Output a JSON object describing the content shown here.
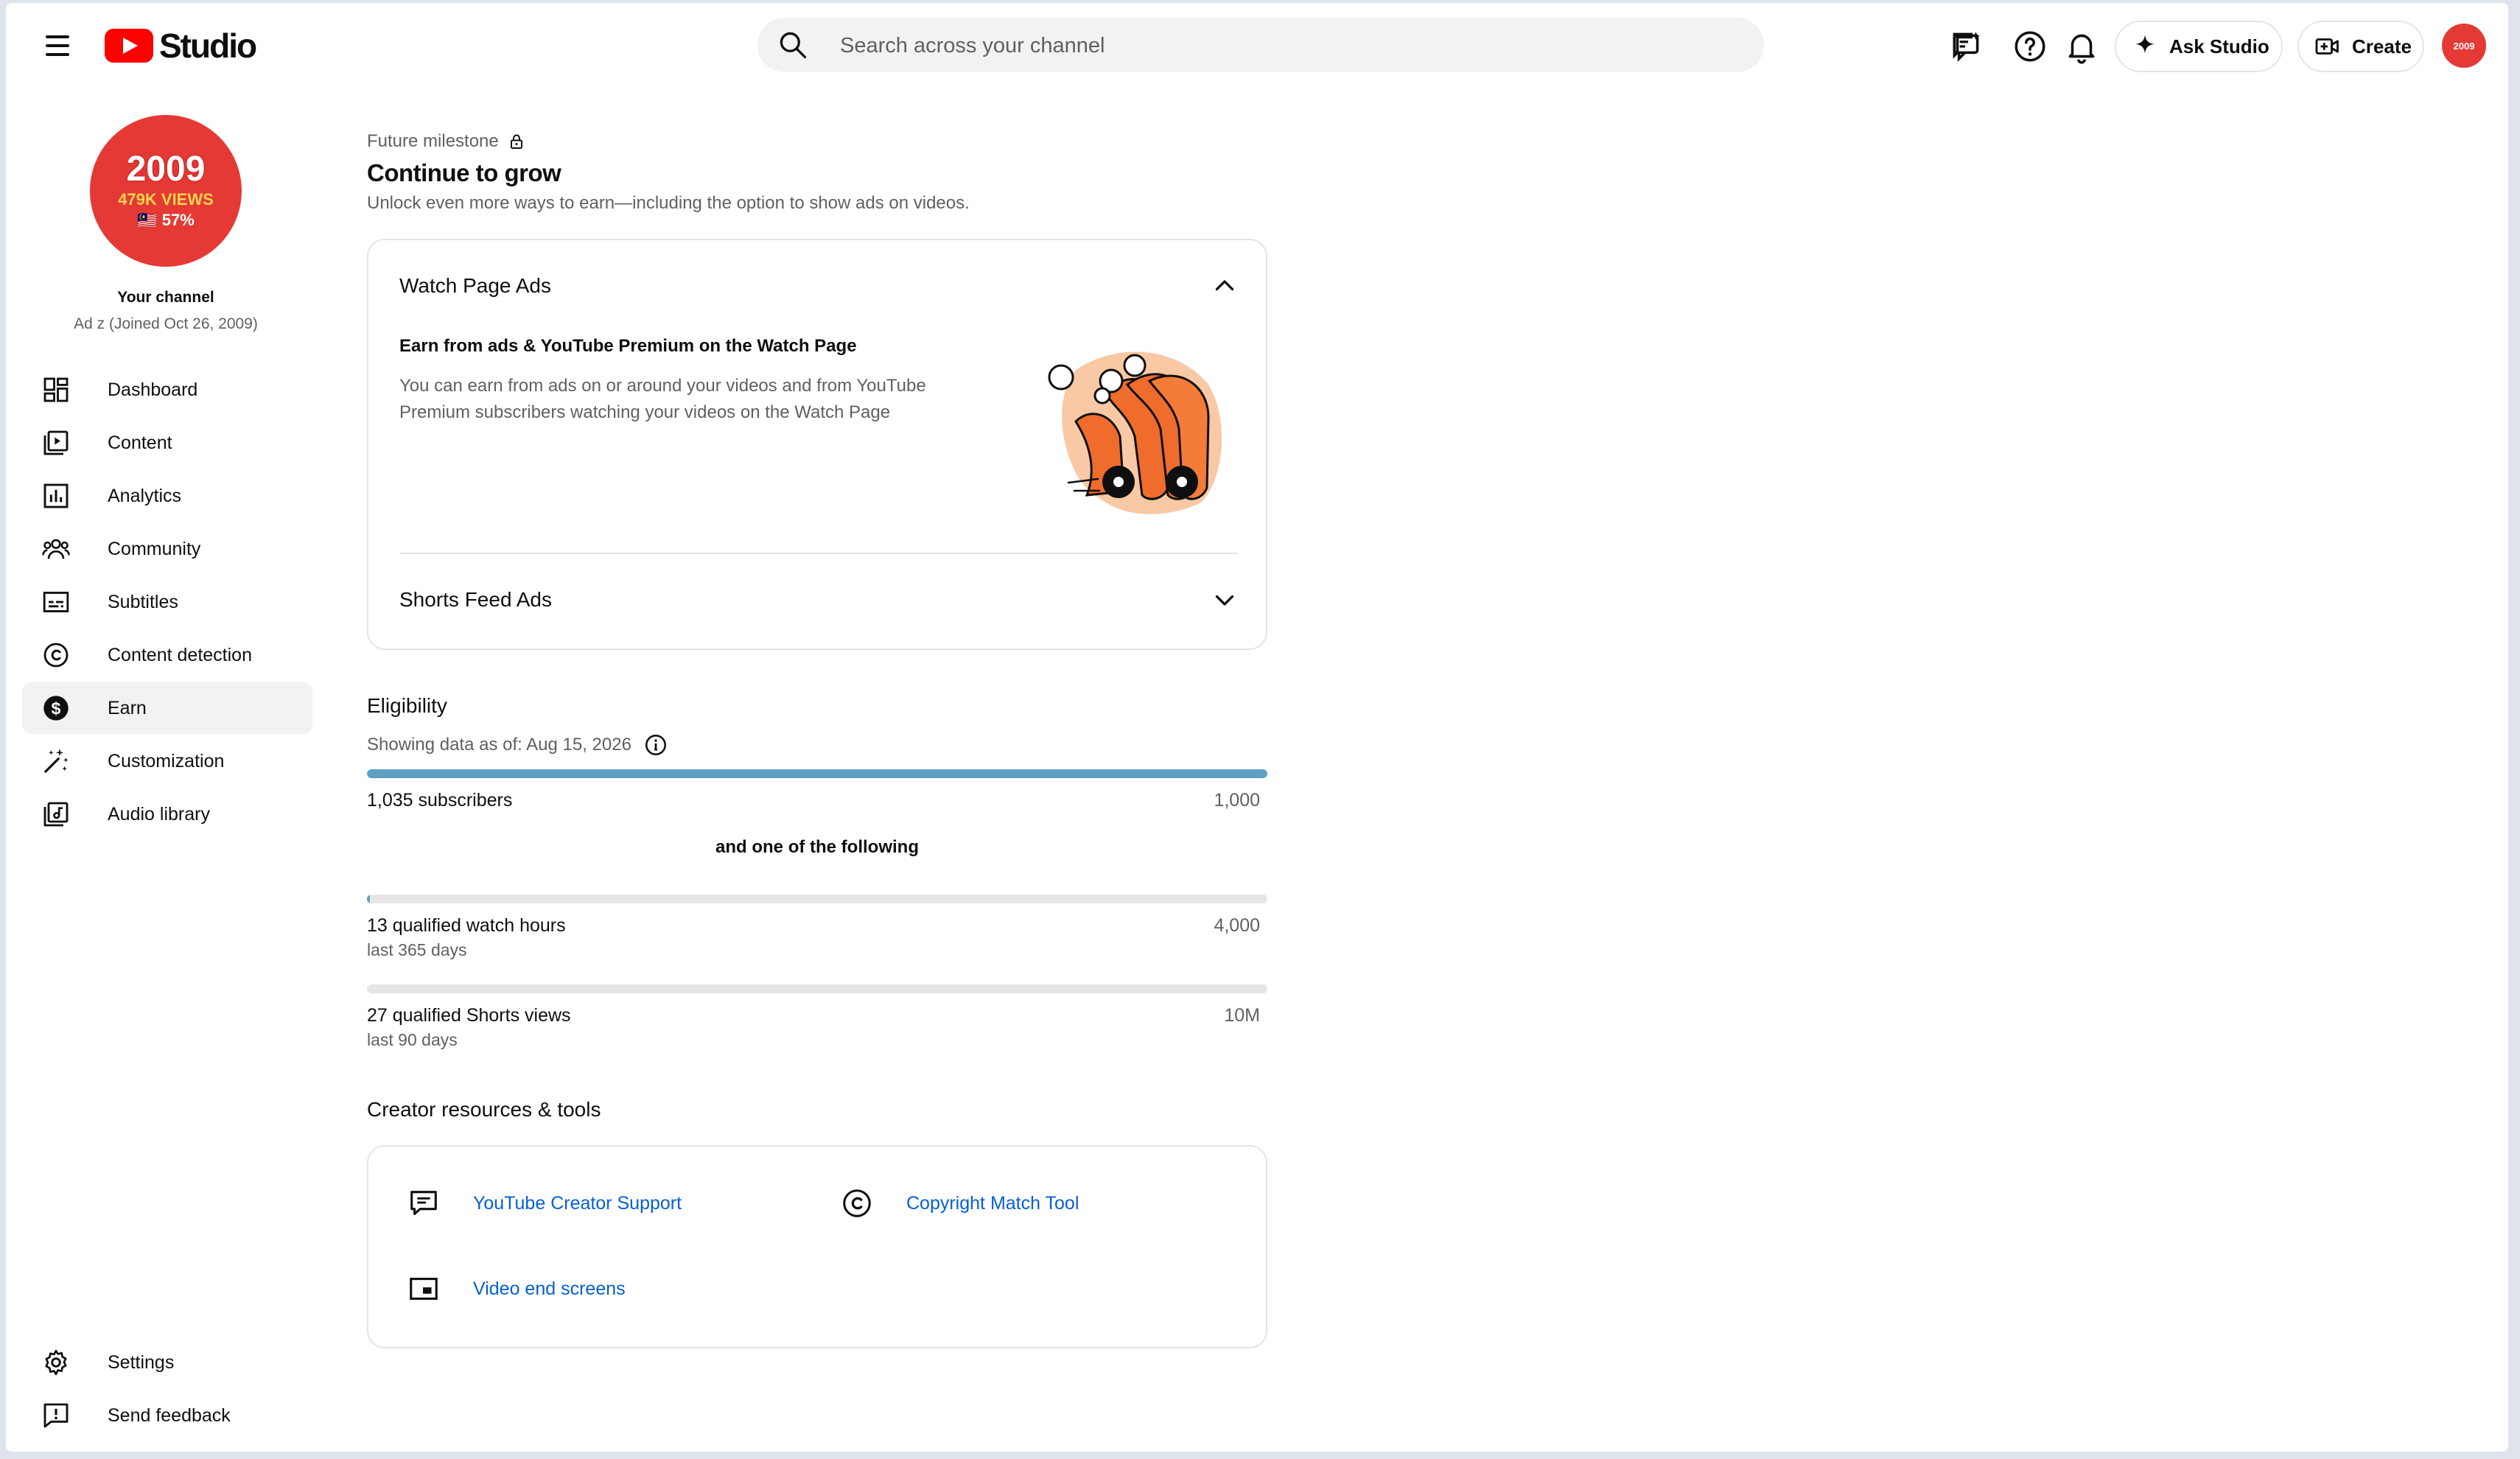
{
  "header": {
    "logo_text": "Studio",
    "search_placeholder": "Search across your channel",
    "ask_studio_label": "Ask Studio",
    "create_label": "Create",
    "avatar_small_text": "2009"
  },
  "channel": {
    "avatar_line1": "2009",
    "avatar_line2": "479K VIEWS",
    "avatar_line3": "🇲🇾 57%",
    "title": "Your channel",
    "subtitle": "Ad z (Joined Oct 26, 2009)"
  },
  "sidebar": {
    "items": [
      {
        "label": "Dashboard",
        "icon": "dashboard-icon"
      },
      {
        "label": "Content",
        "icon": "content-icon"
      },
      {
        "label": "Analytics",
        "icon": "analytics-icon"
      },
      {
        "label": "Community",
        "icon": "community-icon"
      },
      {
        "label": "Subtitles",
        "icon": "subtitles-icon"
      },
      {
        "label": "Content detection",
        "icon": "copyright-icon"
      },
      {
        "label": "Earn",
        "icon": "dollar-icon",
        "active": true
      },
      {
        "label": "Customization",
        "icon": "magic-wand-icon"
      },
      {
        "label": "Audio library",
        "icon": "audio-library-icon"
      }
    ],
    "footer": [
      {
        "label": "Settings",
        "icon": "gear-icon"
      },
      {
        "label": "Send feedback",
        "icon": "feedback-icon"
      }
    ]
  },
  "milestone": {
    "kicker": "Future milestone",
    "title": "Continue to grow",
    "subtitle": "Unlock even more ways to earn—including the option to show ads on videos."
  },
  "ads_card": {
    "watch_page": {
      "title": "Watch Page Ads",
      "expanded": true,
      "heading": "Earn from ads & YouTube Premium on the Watch Page",
      "description": "You can earn from ads on or around your videos and from YouTube Premium subscribers watching your videos on the Watch Page"
    },
    "shorts_feed": {
      "title": "Shorts Feed Ads",
      "expanded": false
    }
  },
  "eligibility": {
    "title": "Eligibility",
    "as_of": "Showing data as of: Aug 15, 2026",
    "subscribers": {
      "label": "1,035 subscribers",
      "goal": "1,000",
      "progress": 1.0
    },
    "connector": "and one of the following",
    "watch_hours": {
      "label": "13 qualified watch hours",
      "goal": "4,000",
      "period": "last 365 days",
      "progress": 0.00325
    },
    "shorts_views": {
      "label": "27 qualified Shorts views",
      "goal": "10M",
      "period": "last 90 days",
      "progress": 2.7e-06
    }
  },
  "resources": {
    "title": "Creator resources & tools",
    "items": [
      {
        "label": "YouTube Creator Support",
        "icon": "chat-icon"
      },
      {
        "label": "Copyright Match Tool",
        "icon": "copyright-icon"
      },
      {
        "label": "Video end screens",
        "icon": "end-screen-icon"
      }
    ]
  },
  "colors": {
    "brand_red": "#ff0000",
    "progress_blue": "#5e9fc2",
    "link_blue": "#065fd4",
    "avatar_red": "#e53935"
  }
}
